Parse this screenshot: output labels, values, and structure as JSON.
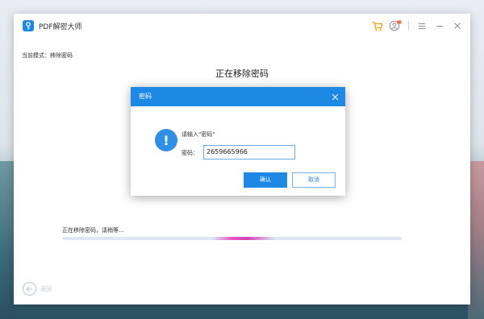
{
  "app": {
    "title": "PDF解密大师"
  },
  "mode": {
    "label": "当前模式：移除密码"
  },
  "main": {
    "title": "正在移除密码"
  },
  "progress": {
    "text": "正在移除密码，请稍等...",
    "value": 0.5
  },
  "footer": {
    "back_label": "返回"
  },
  "dialog": {
    "title": "密码",
    "prompt": "请输入\"密码\"",
    "field_label": "密码：",
    "field_value": "2659665966",
    "ok_label": "确认",
    "cancel_label": "取消"
  },
  "icons": {
    "cart": "cart-icon",
    "user": "user-icon",
    "menu": "menu-icon",
    "minimize": "minimize-icon",
    "close": "close-icon",
    "warning": "exclamation-icon",
    "back": "back-arrow-icon"
  },
  "colors": {
    "accent": "#1e88e5",
    "progress_glow": "#e85cc8",
    "cart": "#f39c12",
    "badge": "#f06b3a"
  }
}
